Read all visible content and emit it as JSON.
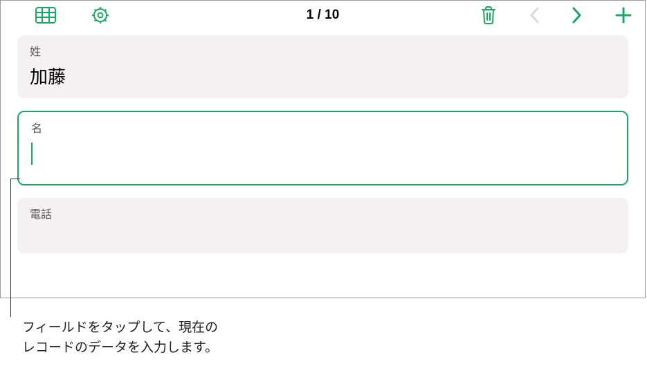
{
  "toolbar": {
    "position": "1 / 10"
  },
  "fields": [
    {
      "label": "姓",
      "value": "加藤",
      "active": false
    },
    {
      "label": "名",
      "value": "",
      "active": true
    },
    {
      "label": "電話",
      "value": "",
      "active": false
    }
  ],
  "callout": {
    "line1": "フィールドをタップして、現在の",
    "line2": "レコードのデータを入力します。"
  },
  "colors": {
    "accent": "#1aa965",
    "disabled": "#c7c7c7"
  }
}
